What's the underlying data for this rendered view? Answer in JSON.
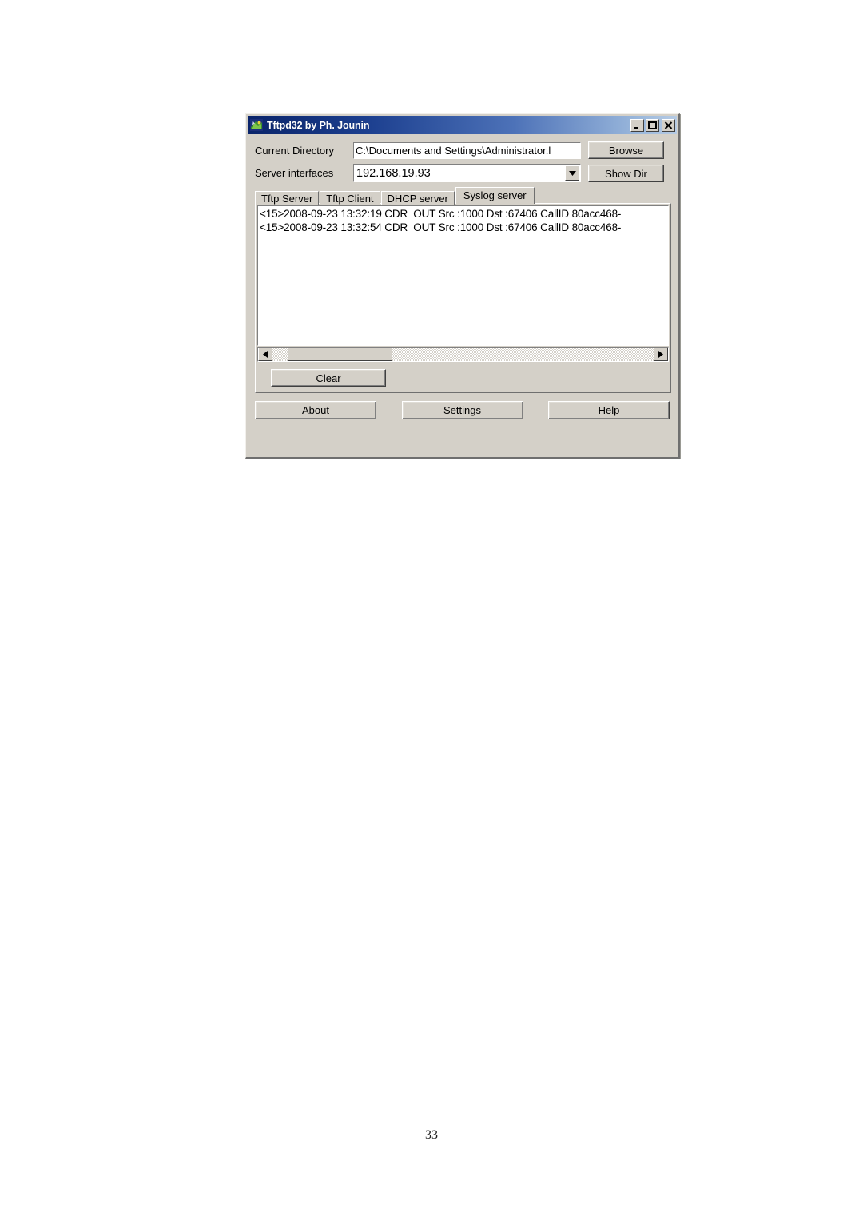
{
  "document": {
    "page_number": "33"
  },
  "window": {
    "title": "Tftpd32 by Ph. Jounin",
    "icon": "tftpd32-app-icon",
    "controls": {
      "minimize": "minimize-icon",
      "maximize": "maximize-icon",
      "close": "close-icon"
    }
  },
  "form": {
    "current_directory": {
      "label": "Current Directory",
      "value": "C:\\Documents and Settings\\Administrator.l"
    },
    "server_interfaces": {
      "label": "Server interfaces",
      "value": "192.168.19.93",
      "dropdown_icon": "chevron-down-icon"
    },
    "browse_label": "Browse",
    "show_dir_label": "Show Dir"
  },
  "tabs": [
    {
      "label": "Tftp Server",
      "active": false
    },
    {
      "label": "Tftp Client",
      "active": false
    },
    {
      "label": "DHCP server",
      "active": false
    },
    {
      "label": "Syslog server",
      "active": true
    }
  ],
  "syslog": {
    "lines": [
      "<15>2008-09-23 13:32:19 CDR  OUT Src :1000 Dst :67406 CallID 80acc468-",
      "<15>2008-09-23 13:32:54 CDR  OUT Src :1000 Dst :67406 CallID 80acc468-"
    ],
    "scrollbar": {
      "left_arrow_icon": "triangle-left-icon",
      "right_arrow_icon": "triangle-right-icon",
      "thumb_position_percent": 4,
      "thumb_width_percent": 27.5
    },
    "clear_label": "Clear"
  },
  "footer": {
    "about_label": "About",
    "settings_label": "Settings",
    "help_label": "Help"
  },
  "colors": {
    "titlebar_start": "#0a246a",
    "titlebar_end": "#b6cbe4",
    "dialog_face": "#d4d0c8",
    "field_background": "#ffffff",
    "text": "#000000"
  }
}
